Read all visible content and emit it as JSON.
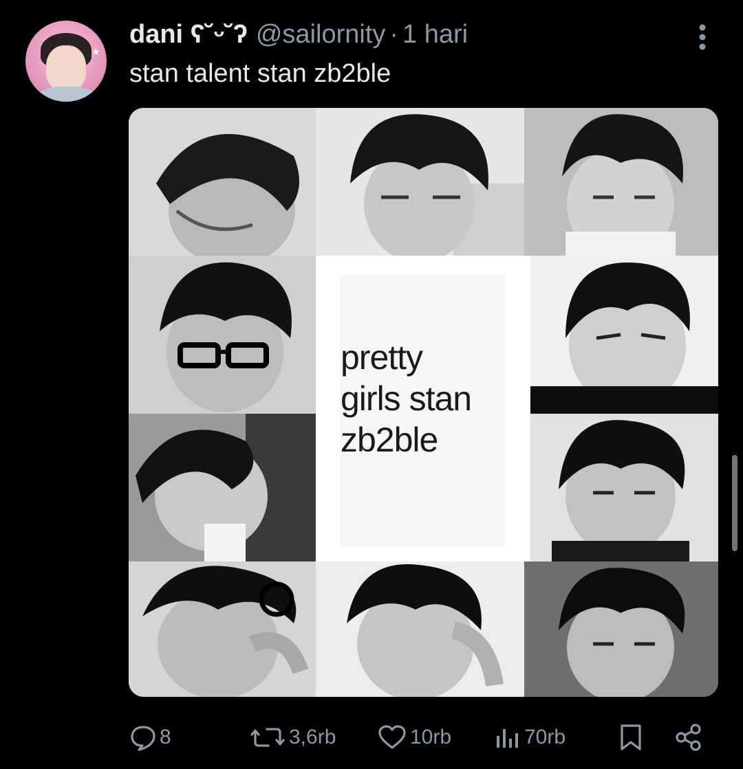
{
  "tweet": {
    "display_name": "dani ʕ˘ᵕ˘ʔ",
    "handle": "@sailornity",
    "separator": "·",
    "time": "1 hari",
    "text": "stan talent stan zb2ble",
    "image_caption_lines": [
      "pretty",
      "girls stan",
      "zb2ble"
    ]
  },
  "actions": {
    "replies": "8",
    "reposts": "3,6rb",
    "likes": "10rb",
    "views": "70rb"
  },
  "icons": {
    "more": "more-vertical-icon",
    "reply": "reply-icon",
    "repost": "repost-icon",
    "like": "heart-icon",
    "views": "views-icon",
    "bookmark": "bookmark-icon",
    "share": "share-icon"
  },
  "colors": {
    "background": "#000000",
    "primary_text": "#e7e9ea",
    "secondary_text": "#8b98a5"
  }
}
